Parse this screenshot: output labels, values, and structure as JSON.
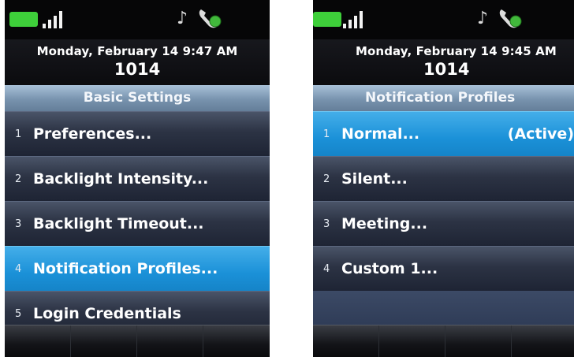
{
  "colors": {
    "accent": "#1b91d8",
    "battery": "#3ecf3a",
    "title_bar": "#7893ae"
  },
  "left": {
    "status": {
      "music_icon": "♪",
      "battery_icon": "battery-icon",
      "signal_icon": "signal-bars-icon",
      "handset_icon": "handset-icon"
    },
    "date": "Monday, February 14 9:47 AM",
    "extension": "1014",
    "title": "Basic Settings",
    "items": [
      {
        "num": "1",
        "label": "Preferences..."
      },
      {
        "num": "2",
        "label": "Backlight Intensity..."
      },
      {
        "num": "3",
        "label": "Backlight Timeout..."
      },
      {
        "num": "4",
        "label": "Notification Profiles...",
        "selected": true
      },
      {
        "num": "5",
        "label": "Login Credentials"
      }
    ]
  },
  "right": {
    "status": {
      "music_icon": "♪",
      "battery_icon": "battery-icon",
      "signal_icon": "signal-bars-icon",
      "handset_icon": "handset-icon"
    },
    "date": "Monday, February 14 9:45 AM",
    "extension": "1014",
    "title": "Notification Profiles",
    "items": [
      {
        "num": "1",
        "label": "Normal...",
        "status": "(Active)",
        "selected": true
      },
      {
        "num": "2",
        "label": "Silent..."
      },
      {
        "num": "3",
        "label": "Meeting..."
      },
      {
        "num": "4",
        "label": "Custom 1..."
      }
    ]
  }
}
